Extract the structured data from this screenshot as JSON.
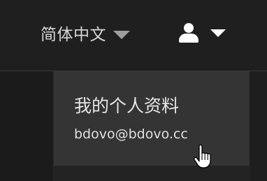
{
  "header": {
    "language_selector": {
      "label": "简体中文",
      "icon": "chevron-down-icon"
    },
    "user_menu": {
      "icon": "user-icon",
      "caret_icon": "chevron-down-icon"
    }
  },
  "dropdown": {
    "profile_item": {
      "title": "我的个人资料",
      "email": "bdovo@bdovo.cc"
    }
  },
  "cursor": {
    "icon": "hand-pointer-icon"
  },
  "colors": {
    "background": "#1e1e1e",
    "topbar": "#1f1f1f",
    "dropdown_background": "#2b2b2b",
    "dropdown_hover": "#343434",
    "text": "#e6e6e6",
    "caret_gray": "#9e9e9e"
  }
}
